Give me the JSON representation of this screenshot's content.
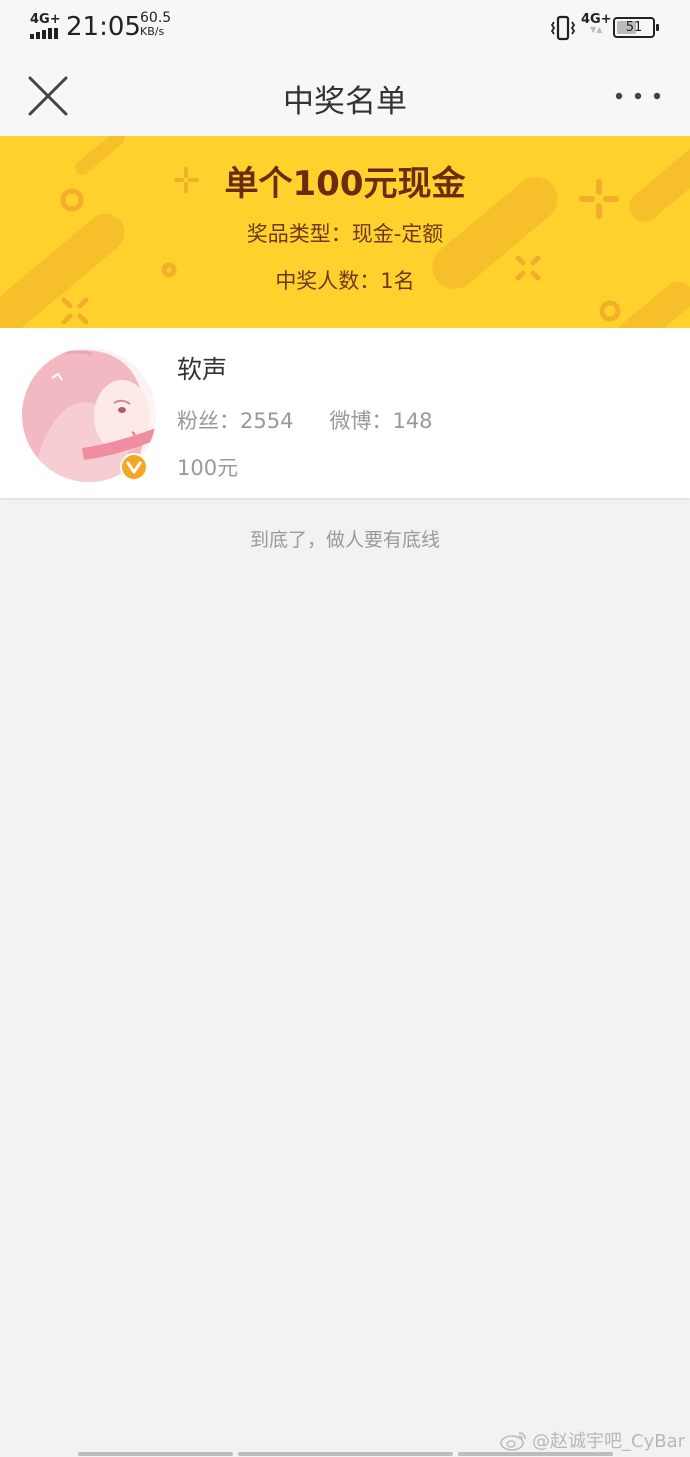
{
  "status_bar": {
    "network_tag": "4G+",
    "time": "21:05",
    "speed_value": "60.5",
    "speed_unit": "KB/s",
    "network_type_right": "4G+",
    "battery_level": "51",
    "icons": [
      "signal-icon",
      "vibrate-icon",
      "battery-icon"
    ]
  },
  "nav": {
    "title": "中奖名单",
    "close_icon": "close-icon",
    "more_icon": "more-icon"
  },
  "banner": {
    "title": "单个100元现金",
    "prize_type": "奖品类型：现金-定额",
    "winner_count": "中奖人数：1名",
    "background_color": "#ffd12c",
    "decoration_color": "#f5b82a"
  },
  "winners": [
    {
      "name": "软声",
      "followers": "粉丝：2554",
      "posts": "微博：148",
      "prize": "100元",
      "verified_icon": "verified-badge-icon",
      "badge_color": "#f5a623"
    }
  ],
  "list_end_text": "到底了，做人要有底线",
  "watermark": {
    "text": "@赵诚宇吧_CyBar",
    "icon": "weibo-icon"
  }
}
